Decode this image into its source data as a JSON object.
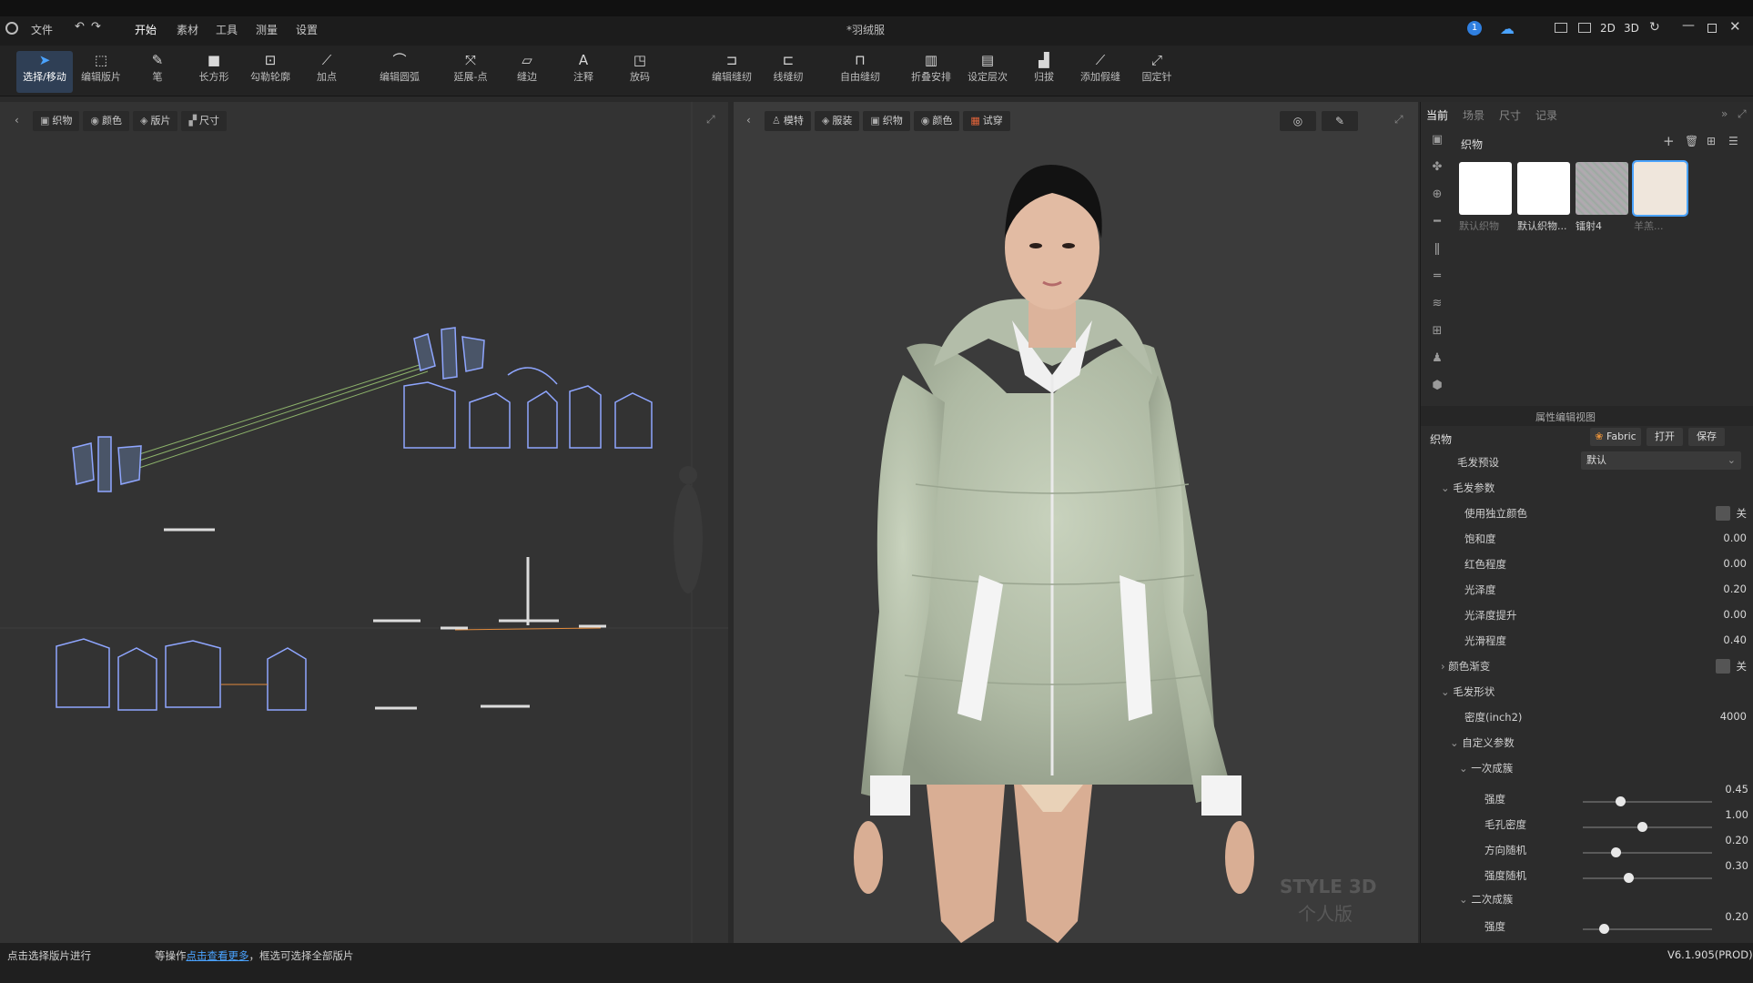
{
  "window": {
    "title": "*羽绒服",
    "version": "V6.1.905(PROD)",
    "view_modes": [
      "2D",
      "3D"
    ],
    "notification_count": "1"
  },
  "menu": {
    "items": [
      "文件",
      "开始",
      "素材",
      "工具",
      "测量",
      "设置"
    ],
    "active": "开始"
  },
  "toolbar": {
    "tools": [
      {
        "label": "选择/移动",
        "icon": "arrow-icon"
      },
      {
        "label": "编辑版片",
        "icon": "edit-pattern-icon"
      },
      {
        "label": "笔",
        "icon": "pen-icon"
      },
      {
        "label": "长方形",
        "icon": "rectangle-icon"
      },
      {
        "label": "勾勒轮廓",
        "icon": "outline-icon"
      },
      {
        "label": "加点",
        "icon": "add-point-icon"
      },
      {
        "label": "编辑圆弧",
        "icon": "arc-icon"
      },
      {
        "label": "延展-点",
        "icon": "extend-point-icon"
      },
      {
        "label": "缝边",
        "icon": "seam-allowance-icon"
      },
      {
        "label": "注释",
        "icon": "annotation-icon"
      },
      {
        "label": "放码",
        "icon": "grading-icon"
      },
      {
        "label": "编辑缝纫",
        "icon": "edit-sewing-icon"
      },
      {
        "label": "线缝纫",
        "icon": "line-sewing-icon"
      },
      {
        "label": "自由缝纫",
        "icon": "free-sewing-icon"
      },
      {
        "label": "折叠安排",
        "icon": "fold-arrange-icon"
      },
      {
        "label": "设定层次",
        "icon": "layer-icon"
      },
      {
        "label": "归拔",
        "icon": "shrink-icon"
      },
      {
        "label": "添加假缝",
        "icon": "tack-icon"
      },
      {
        "label": "固定针",
        "icon": "pin-icon"
      }
    ]
  },
  "panel2d": {
    "chips": [
      "织物",
      "颜色",
      "版片",
      "尺寸"
    ]
  },
  "panel3d": {
    "chips": [
      "模特",
      "服装",
      "织物",
      "颜色",
      "试穿"
    ],
    "watermark_line1": "STYLE 3D",
    "watermark_line2": "个人版"
  },
  "right_panel": {
    "tabs": [
      "当前",
      "场景",
      "尺寸",
      "记录"
    ],
    "active_tab": "当前",
    "library_title": "织物",
    "swatches": [
      {
        "label": "默认织物",
        "color": "#ffffff"
      },
      {
        "label": "默认织物...",
        "color": "#ffffff"
      },
      {
        "label": "镭射4",
        "color": "#9aa7a0"
      },
      {
        "label": "羊羔...",
        "color": "#efe6dc"
      }
    ],
    "property_editor_title": "属性编辑视图",
    "fabric_section": "织物",
    "fabric_button": "Fabric",
    "open_button": "打开",
    "save_button": "保存",
    "hair_preset_label": "毛发预设",
    "hair_preset_value": "默认",
    "hair_params": "毛发参数",
    "rows": [
      {
        "label": "使用独立颜色",
        "value": "关"
      },
      {
        "label": "饱和度",
        "value": "0.00"
      },
      {
        "label": "红色程度",
        "value": "0.00"
      },
      {
        "label": "光泽度",
        "value": "0.20"
      },
      {
        "label": "光泽度提升",
        "value": "0.00"
      },
      {
        "label": "光滑程度",
        "value": "0.40"
      }
    ],
    "color_gradient_label": "颜色渐变",
    "color_gradient_value": "关",
    "hair_shape": "毛发形状",
    "density_label": "密度(inch2)",
    "density_value": "4000",
    "custom_params": "自定义参数",
    "first_cluster": "一次成簇",
    "sliders1": [
      {
        "label": "强度",
        "value": "0.45",
        "level": 0.25
      },
      {
        "label": "毛孔密度",
        "value": "1.00",
        "level": 0.42
      },
      {
        "label": "方向随机",
        "value": "0.20",
        "level": 0.22
      },
      {
        "label": "强度随机",
        "value": "0.30",
        "level": 0.32
      }
    ],
    "second_cluster": "二次成簇",
    "sliders2": [
      {
        "label": "强度",
        "value": "0.20",
        "level": 0.13
      }
    ]
  },
  "status": {
    "text_a": "点击选择版片进行",
    "text_b": "等操作",
    "link": "点击查看更多",
    "text_c": "，框选可选择全部版片"
  },
  "colors": {
    "accent": "#4aa3ff",
    "jacket": "#b9c6b0",
    "bg_dark": "#1c1c1c"
  }
}
